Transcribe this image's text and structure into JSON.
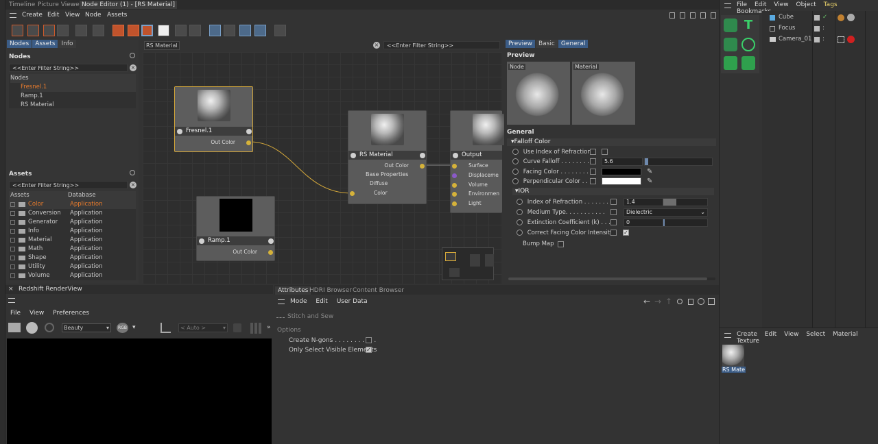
{
  "top_tabs": {
    "timeline": "Timeline",
    "picture_viewer": "Picture Viewer",
    "node_editor": "Node Editor (1) - [RS Material]"
  },
  "node_editor_menu": [
    "Create",
    "Edit",
    "View",
    "Node",
    "Assets"
  ],
  "left_panel": {
    "tabs": [
      "Nodes",
      "Assets",
      "Info"
    ],
    "nodes_header": "Nodes",
    "filter_placeholder": "<<Enter Filter String>>",
    "nodes_list_header": "Nodes",
    "nodes": [
      "Fresnel.1",
      "Ramp.1",
      "RS Material"
    ],
    "assets_header": "Assets",
    "assets_filter": "<<Enter Filter String>>",
    "assets_columns": [
      "Assets",
      "Database"
    ],
    "assets": [
      {
        "name": "Color",
        "db": "Application"
      },
      {
        "name": "Conversion",
        "db": "Application"
      },
      {
        "name": "Generator",
        "db": "Application"
      },
      {
        "name": "Info",
        "db": "Application"
      },
      {
        "name": "Material",
        "db": "Application"
      },
      {
        "name": "Math",
        "db": "Application"
      },
      {
        "name": "Shape",
        "db": "Application"
      },
      {
        "name": "Utility",
        "db": "Application"
      },
      {
        "name": "Volume",
        "db": "Application"
      }
    ]
  },
  "canvas": {
    "breadcrumb": "RS Material",
    "filter": "<<Enter Filter String>>",
    "nodes": {
      "fresnel": {
        "title": "Fresnel.1",
        "port": "Out Color"
      },
      "ramp": {
        "title": "Ramp.1",
        "port": "Out Color"
      },
      "rsmat": {
        "title": "RS Material",
        "out": "Out Color",
        "group": "Base Properties",
        "sub": "Diffuse",
        "in": "Color"
      },
      "output": {
        "title": "Output",
        "ports": [
          "Surface",
          "Displaceme",
          "Volume",
          "Environmen",
          "Light"
        ]
      }
    }
  },
  "attributes_right": {
    "tabs": [
      "Preview",
      "Basic",
      "General"
    ],
    "preview_label": "Preview",
    "preview_node": "Node",
    "preview_material": "Material",
    "general_label": "General",
    "falloff_group": "Falloff Color",
    "use_ior": "Use Index of Refraction",
    "curve_falloff": "Curve Falloff . . . . . . . .",
    "curve_falloff_value": "5.6",
    "facing_color": "Facing Color . . . . . . . .",
    "perp_color": "Perpendicular Color . . .",
    "ior_group": "IOR",
    "ior_label": "Index of Refraction . . . . . . . .",
    "ior_value": "1.4",
    "medium_label": "Medium Type. . . . . . . . . . .",
    "medium_value": "Dielectric",
    "extinction_label": "Extinction Coefficient (k) . . . .",
    "extinction_value": "0",
    "correct_facing": "Correct Facing Color Intensity",
    "bump_map": "Bump Map",
    "colors": {
      "facing": "#000000",
      "perpendicular": "#ffffff"
    }
  },
  "render_view": {
    "title": "Redshift RenderView",
    "menu": [
      "File",
      "View",
      "Preferences"
    ],
    "aov": "Beauty",
    "rgb": "RGB",
    "auto": "< Auto >"
  },
  "bottom_attributes": {
    "tabs": [
      "Attributes",
      "HDRI Browser",
      "Content Browser"
    ],
    "menu": [
      "Mode",
      "Edit",
      "User Data"
    ],
    "tool": "Stitch and Sew",
    "options": "Options",
    "create_ngons": "Create N-gons . . . . . . . . . . .",
    "only_visible": "Only Select Visible Elements"
  },
  "object_manager": {
    "menu": [
      "File",
      "Edit",
      "View",
      "Object",
      "Tags",
      "Bookmarks"
    ],
    "objects": [
      "Cube",
      "Focus",
      "Camera_01"
    ]
  },
  "material_manager": {
    "menu": [
      "Create",
      "Edit",
      "View",
      "Select",
      "Material",
      "Texture"
    ],
    "material": "RS Mate"
  }
}
